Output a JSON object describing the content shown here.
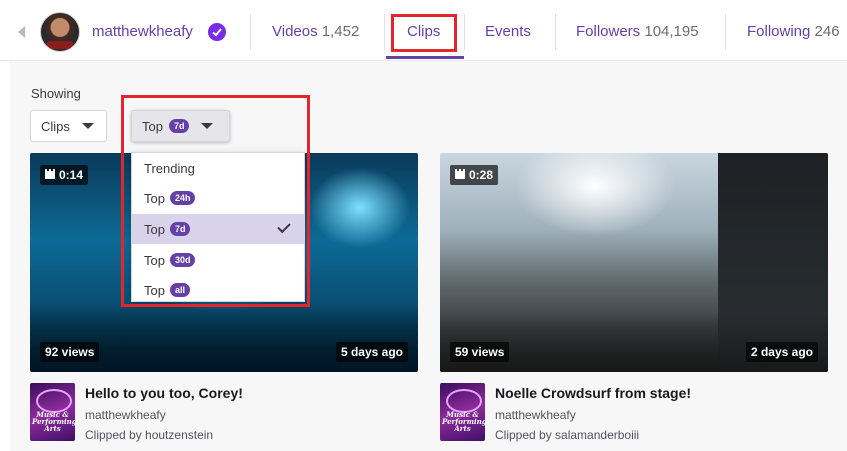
{
  "nav": {
    "channel_name": "matthewkheafy",
    "tabs": [
      {
        "label": "Videos",
        "count": "1,452"
      },
      {
        "label": "Clips",
        "count": ""
      },
      {
        "label": "Events",
        "count": ""
      },
      {
        "label": "Followers",
        "count": "104,195"
      },
      {
        "label": "Following",
        "count": "246"
      }
    ],
    "active_tab": "Clips",
    "accent_color": "#6441a5",
    "highlight_color": "#e3252c"
  },
  "filters": {
    "showing_label": "Showing",
    "type_select": "Clips",
    "period_select": {
      "label": "Top",
      "pill": "7d"
    }
  },
  "dropdown": {
    "items": [
      {
        "label": "Trending",
        "pill": ""
      },
      {
        "label": "Top",
        "pill": "24h"
      },
      {
        "label": "Top",
        "pill": "7d",
        "selected": true
      },
      {
        "label": "Top",
        "pill": "30d"
      },
      {
        "label": "Top",
        "pill": "all"
      }
    ]
  },
  "clips": [
    {
      "duration": "0:14",
      "views": "92 views",
      "age": "5 days ago",
      "title": "Hello to you too, Corey!",
      "channel": "matthewkheafy",
      "clipped_by": "Clipped by houtzenstein",
      "game_art_text": "Music & Performing Arts"
    },
    {
      "duration": "0:28",
      "views": "59 views",
      "age": "2 days ago",
      "title": "Noelle Crowdsurf from stage!",
      "channel": "matthewkheafy",
      "clipped_by": "Clipped by salamanderboiii",
      "game_art_text": "Music & Performing Arts"
    }
  ]
}
